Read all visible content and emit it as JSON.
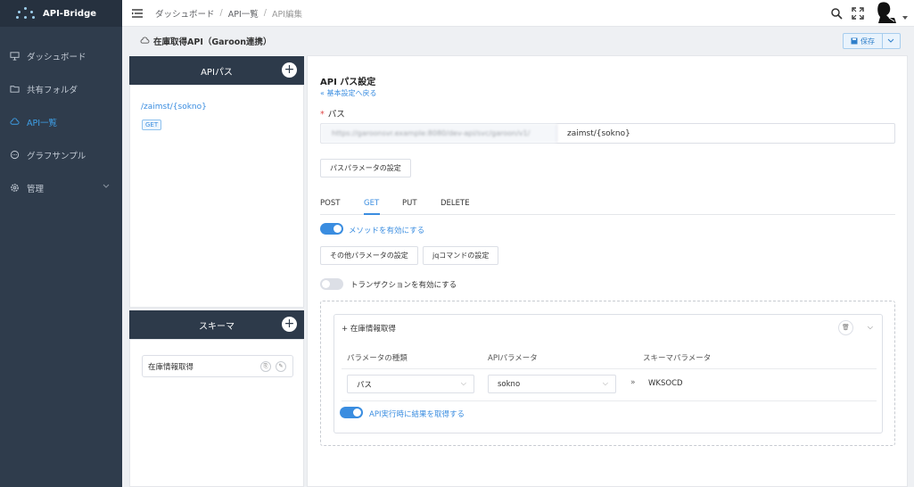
{
  "app": {
    "name": "API-Bridge"
  },
  "sidebar": {
    "items": [
      {
        "label": "ダッシュボード",
        "icon": "monitor-icon",
        "active": false
      },
      {
        "label": "共有フォルダ",
        "icon": "folder-icon",
        "active": false
      },
      {
        "label": "API一覧",
        "icon": "cloud-icon",
        "active": true
      },
      {
        "label": "グラフサンプル",
        "icon": "chat-icon",
        "active": false
      },
      {
        "label": "管理",
        "icon": "gear-icon",
        "active": false,
        "expandable": true
      }
    ]
  },
  "breadcrumb": {
    "items": [
      "ダッシュボード",
      "API一覧",
      "API編集"
    ],
    "separator": "/"
  },
  "page": {
    "title": "在庫取得API（Garoon連携）",
    "save_label": "保存"
  },
  "api_path_panel": {
    "title": "APIパス",
    "path": "/zaimst/{sokno}",
    "method_badge": "GET"
  },
  "schema_panel": {
    "title": "スキーマ",
    "item_label": "在庫情報取得"
  },
  "editor": {
    "section_title": "API パス設定",
    "back_label": "基本設定へ戻る",
    "path_label": "パス",
    "url_prefix": "https://garoonsvr.example:8080/dev-api/svc/garoon/v1/",
    "path_value": "zaimst/{sokno}",
    "path_param_button": "パスパラメータの設定",
    "tabs": [
      {
        "label": "POST",
        "active": false
      },
      {
        "label": "GET",
        "active": true
      },
      {
        "label": "PUT",
        "active": false
      },
      {
        "label": "DELETE",
        "active": false
      }
    ],
    "enable_method_label": "メソッドを有効にする",
    "enable_method_on": true,
    "other_params_button": "その他パラメータの設定",
    "jq_button": "jqコマンドの設定",
    "transaction_label": "トランザクションを有効にする",
    "transaction_on": false,
    "mapping": {
      "card_title": "在庫情報取得",
      "columns": [
        "パラメータの種類",
        "APIパラメータ",
        "スキーマパラメータ"
      ],
      "param_type": "パス",
      "api_param": "sokno",
      "schema_param": "WKSOCD",
      "fetch_label": "API実行時に結果を取得する",
      "fetch_on": true
    }
  },
  "colors": {
    "accent": "#3a8de0",
    "sidebar": "#2f3c4c",
    "panel_head": "#2d3a4a"
  }
}
